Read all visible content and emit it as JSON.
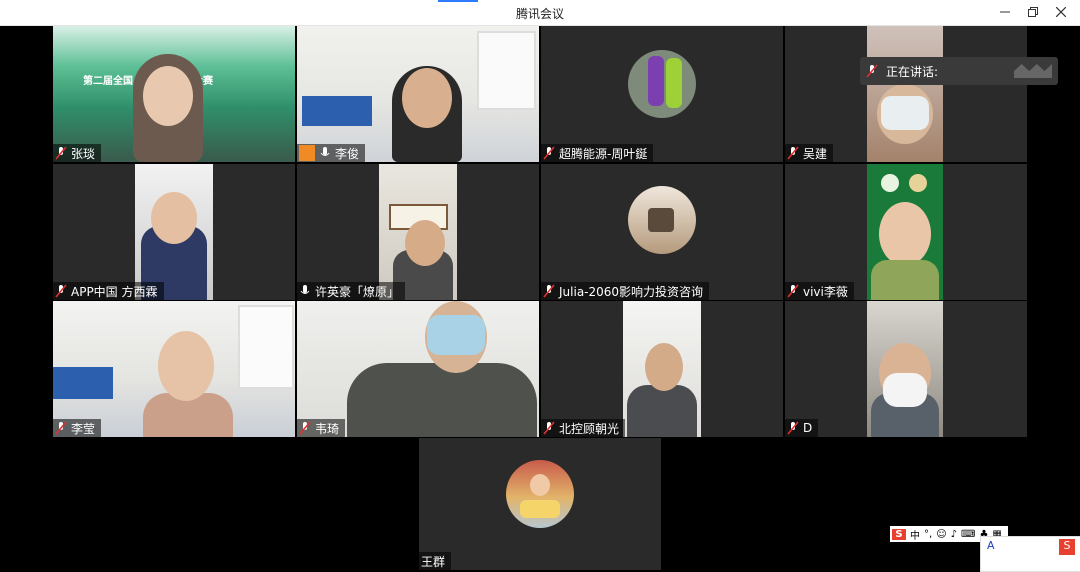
{
  "window": {
    "title": "腾讯会议"
  },
  "speaking": {
    "label": "正在讲话:"
  },
  "participants": [
    {
      "name": "张琰",
      "muted": true,
      "banner": "第二届全国…环科技创新大赛"
    },
    {
      "name": "李俊",
      "muted": false
    },
    {
      "name": "超腾能源-周叶鋋",
      "muted": true
    },
    {
      "name": "吴建",
      "muted": true
    },
    {
      "name": "APP中国 方西霖",
      "muted": true
    },
    {
      "name": "许英豪「燎原」",
      "muted": false
    },
    {
      "name": "Julia-2060影响力投资咨询",
      "muted": true
    },
    {
      "name": "vivi李薇",
      "muted": true
    },
    {
      "name": "李莹",
      "muted": true
    },
    {
      "name": "韦琦",
      "muted": true
    },
    {
      "name": "北控顾朝光",
      "muted": true
    },
    {
      "name": "D",
      "muted": true
    },
    {
      "name": "王群",
      "muted": false
    }
  ],
  "ime": {
    "logo": "S",
    "mode": "中",
    "input_char": "A"
  },
  "colors": {
    "accent": "#2f7bff",
    "tile_bg": "#2a2a2a",
    "ime_red": "#e8402f"
  }
}
